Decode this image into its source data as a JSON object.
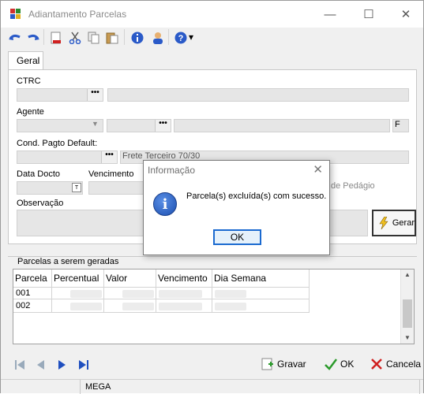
{
  "window": {
    "title": "Adiantamento Parcelas",
    "minimize": "—",
    "maximize": "☐",
    "close": "✕"
  },
  "toolbar": {
    "icons": [
      "undo-icon",
      "redo-icon",
      "delete-document-icon",
      "cut-icon",
      "copy-icon",
      "paste-icon",
      "info-icon",
      "user-icon",
      "help-icon"
    ],
    "dropdown_arrow": "▾"
  },
  "tabs": {
    "geral": "Geral"
  },
  "form": {
    "ctrc_label": "CTRC",
    "agente_label": "Agente",
    "agente_f": "F",
    "cond_pagto_label": "Cond. Pagto Default:",
    "cond_pagto_value": "Frete Terceiro 70/30",
    "data_docto_label": "Data Docto",
    "vencimento_label": "Vencimento",
    "pedagio_label": "de Pedágio",
    "observacao_label": "Observação",
    "dots": "•••",
    "date_btn": "📅"
  },
  "gerar_label": "Gerar",
  "parcelas": {
    "section_label": "Parcelas  a serem geradas",
    "columns": [
      "Parcela",
      "Percentual",
      "Valor",
      "Vencimento",
      "Dia Semana"
    ],
    "rows": [
      {
        "parcela": "001"
      },
      {
        "parcela": "002"
      }
    ]
  },
  "bottom": {
    "gravar_label": "Gravar",
    "ok_label": "OK",
    "cancela_label": "Cancela"
  },
  "status": {
    "user": "MEGA"
  },
  "dialog": {
    "title": "Informação",
    "message": "Parcela(s) excluída(s) com sucesso.",
    "ok_label": "OK"
  },
  "colors": {
    "ok_border": "#1b6ad0",
    "nav_blue": "#1f4fbf",
    "check_green": "#2a9a2a",
    "cancel_red": "#d02020"
  }
}
